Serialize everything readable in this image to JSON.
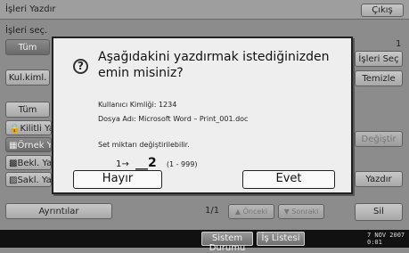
{
  "window": {
    "title": "İşleri Yazdır",
    "exit_label": "Çıkış"
  },
  "background": {
    "section_label": "İşleri seç.",
    "counter": "1",
    "left_buttons": [
      "Tüm",
      "Kul.kiml.",
      "Tüm",
      "Kilitli Yaz.",
      "Örnek Yaz.",
      "Bekl. Yaz.",
      "Sakl. Yaz."
    ],
    "icon_names": [
      "",
      "",
      "",
      "lock-icon",
      "sample-print-icon",
      "hold-print-icon",
      "stored-print-icon"
    ],
    "right_buttons": [
      "İşleri Seç",
      "Temizle",
      "Değiştir",
      "Yazdır",
      "Sil"
    ],
    "details_label": "Ayrıntılar",
    "page_indicator": "1/1",
    "prev_label": "Önceki",
    "next_label": "Sonraki"
  },
  "dialog": {
    "title_line1": "Aşağıdakini yazdırmak istediğinizden",
    "title_line2": "emin misiniz?",
    "user_id": "Kullanıcı Kimliği: 1234",
    "file_name": "Dosya Adı: Microsoft Word – Print_001.doc",
    "info": "Set miktarı değiştirilebilir.",
    "set_arrow": "1→",
    "set_value": "__2",
    "set_range": "(1 - 999)",
    "no_label": "Hayır",
    "yes_label": "Evet"
  },
  "bottom_bar": {
    "system_status": "Sistem Durumu",
    "job_list": "İş Listesi",
    "date": "7 NOV 2007",
    "time": "0:01"
  }
}
